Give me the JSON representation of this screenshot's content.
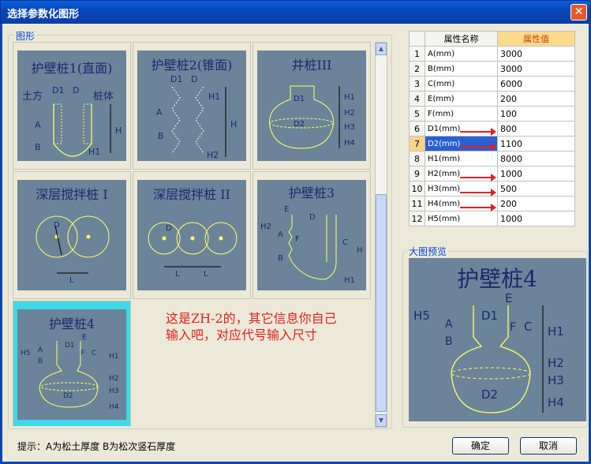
{
  "window": {
    "title": "选择参数化图形",
    "close_glyph": "✕"
  },
  "gallery": {
    "label": "图形",
    "items": [
      {
        "name": "护壁桩1(直面)",
        "labels": [
          "土方",
          "D1",
          "D",
          "桩体",
          "A",
          "B",
          "H",
          "H1"
        ]
      },
      {
        "name": "护壁桩2(锥面)",
        "labels": [
          "D1",
          "D",
          "A",
          "B",
          "H1",
          "H",
          "H2"
        ]
      },
      {
        "name": "井桩III",
        "labels": [
          "D1",
          "D2",
          "H1",
          "H2",
          "H3",
          "H4"
        ]
      },
      {
        "name": "深层搅拌桩 I",
        "labels": [
          "D",
          "L"
        ]
      },
      {
        "name": "深层搅拌桩 II",
        "labels": [
          "D",
          "L",
          "L"
        ]
      },
      {
        "name": "护壁桩3",
        "labels": [
          "E",
          "D",
          "H2",
          "A",
          "F",
          "B",
          "C",
          "H",
          "H1"
        ]
      },
      {
        "name": "护壁桩4",
        "labels": [
          "E",
          "D1",
          "H5",
          "A",
          "B",
          "F",
          "C",
          "H1",
          "H2",
          "H3",
          "H4",
          "D2"
        ]
      }
    ]
  },
  "note": [
    "这是ZH-2的，其它信息你自己",
    "输入吧，对应代号输入尺寸"
  ],
  "hint": "提示：A为松土厚度  B为松次竖石厚度",
  "properties": {
    "header_name": "属性名称",
    "header_value": "属性值",
    "rows": [
      {
        "idx": "1",
        "name": "A(mm)",
        "value": "3000"
      },
      {
        "idx": "2",
        "name": "B(mm)",
        "value": "3000"
      },
      {
        "idx": "3",
        "name": "C(mm)",
        "value": "6000"
      },
      {
        "idx": "4",
        "name": "E(mm)",
        "value": "200"
      },
      {
        "idx": "5",
        "name": "F(mm)",
        "value": "100"
      },
      {
        "idx": "6",
        "name": "D1(mm)",
        "value": "800"
      },
      {
        "idx": "7",
        "name": "D2(mm)",
        "value": "1100"
      },
      {
        "idx": "8",
        "name": "H1(mm)",
        "value": "8000"
      },
      {
        "idx": "9",
        "name": "H2(mm)",
        "value": "1000"
      },
      {
        "idx": "10",
        "name": "H3(mm)",
        "value": "500"
      },
      {
        "idx": "11",
        "name": "H4(mm)",
        "value": "200"
      },
      {
        "idx": "12",
        "name": "H5(mm)",
        "value": "1000"
      }
    ]
  },
  "preview": {
    "label": "大图预览",
    "title": "护壁桩4",
    "labels": [
      "E",
      "H5",
      "A",
      "D1",
      "F",
      "C",
      "B",
      "H1",
      "H2",
      "H3",
      "H4",
      "D2"
    ]
  },
  "buttons": {
    "ok": "确定",
    "cancel": "取消"
  },
  "colors": {
    "panel": "#6b8499",
    "line": "#ffff66",
    "title_text": "#1a2a6e",
    "selected": "#3fd9e8",
    "arrow": "#e02020"
  }
}
